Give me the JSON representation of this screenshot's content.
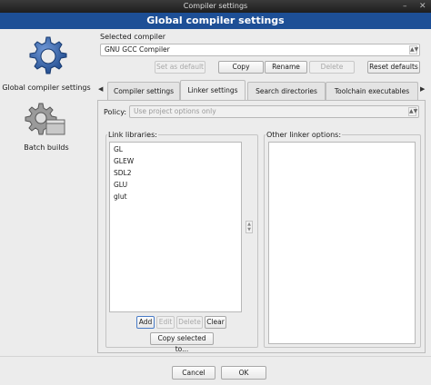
{
  "window": {
    "title": "Compiler settings",
    "header": "Global compiler settings",
    "minimize_glyph": "–",
    "close_glyph": "✕"
  },
  "categories": [
    {
      "label": "Global compiler settings",
      "icon": "gear-icon",
      "selected": true
    },
    {
      "label": "Batch builds",
      "icon": "gear-box-icon",
      "selected": false
    }
  ],
  "compiler": {
    "section_label": "Selected compiler",
    "selected": "GNU GCC Compiler",
    "buttons": {
      "set_default": "Set as default",
      "copy": "Copy",
      "rename": "Rename",
      "delete": "Delete",
      "reset": "Reset defaults"
    }
  },
  "tabs": {
    "scroll_left": "◀",
    "scroll_right": "▶",
    "items": [
      {
        "label": "Compiler settings",
        "active": false
      },
      {
        "label": "Linker settings",
        "active": true
      },
      {
        "label": "Search directories",
        "active": false
      },
      {
        "label": "Toolchain executables",
        "active": false
      }
    ]
  },
  "linker": {
    "policy_label": "Policy:",
    "policy_value": "Use project options only",
    "link_libraries_label": "Link libraries:",
    "libraries": [
      "GL",
      "GLEW",
      "SDL2",
      "GLU",
      "glut"
    ],
    "buttons": {
      "add": "Add",
      "edit": "Edit",
      "delete": "Delete",
      "clear": "Clear",
      "copy_selected": "Copy selected to..."
    },
    "other_options_label": "Other linker options:",
    "other_options_value": ""
  },
  "dialog_buttons": {
    "cancel": "Cancel",
    "ok": "OK"
  },
  "colors": {
    "header_bg": "#1d4f96",
    "titlebar_bg": "#2a2a2a",
    "icon_blue": "#2c5aa0"
  }
}
